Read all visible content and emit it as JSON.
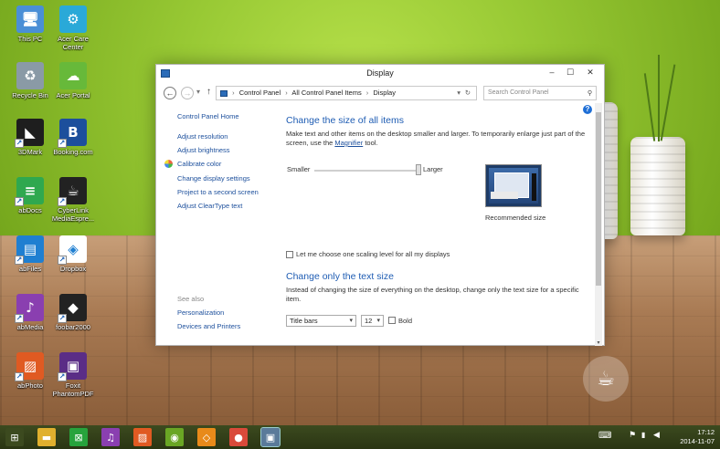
{
  "window": {
    "title": "Display",
    "controls": {
      "minimize": "–",
      "maximize": "☐",
      "close": "✕"
    }
  },
  "address": {
    "breadcrumb": [
      "Control Panel",
      "All Control Panel Items",
      "Display"
    ],
    "search_placeholder": "Search Control Panel"
  },
  "leftnav": {
    "home": "Control Panel Home",
    "items": [
      "Adjust resolution",
      "Adjust brightness",
      "Calibrate color",
      "Change display settings",
      "Project to a second screen",
      "Adjust ClearType text"
    ],
    "see_also_label": "See also",
    "see_also": [
      "Personalization",
      "Devices and Printers"
    ]
  },
  "content": {
    "heading1": "Change the size of all items",
    "para1_a": "Make text and other items on the desktop smaller and larger. To temporarily enlarge just part of the screen, use the",
    "para1_link": "Magnifier",
    "para1_b": "tool.",
    "slider_min": "Smaller",
    "slider_max": "Larger",
    "slider_level": 1.0,
    "preview_caption": "Recommended size",
    "scaling_checkbox": "Let me choose one scaling level for all my displays",
    "scaling_checked": false,
    "heading2": "Change only the text size",
    "para2": "Instead of changing the size of everything on the desktop, change only the text size for a specific item.",
    "item_select": "Title bars",
    "size_select": "12",
    "bold_label": "Bold",
    "bold_checked": false
  },
  "desktop_icons": [
    {
      "label": "This PC",
      "icon": "computer-icon",
      "color": "#4a8fd6"
    },
    {
      "label": "Acer Care Center",
      "icon": "care-center-icon",
      "color": "#2aa9d8"
    },
    {
      "label": "Recycle Bin",
      "icon": "recycle-bin-icon",
      "color": "#8a9aa6"
    },
    {
      "label": "Acer Portal",
      "icon": "cloud-icon",
      "color": "#67b93a"
    },
    {
      "label": "3DMark",
      "icon": "3dmark-icon",
      "color": "#1e1e1e"
    },
    {
      "label": "Booking.com",
      "icon": "booking-icon",
      "color": "#1c4f9c"
    },
    {
      "label": "abDocs",
      "icon": "abdocs-icon",
      "color": "#2fa84f"
    },
    {
      "label": "CyberLink MediaEspre...",
      "icon": "cyberlink-icon",
      "color": "#222222"
    },
    {
      "label": "abFiles",
      "icon": "abfiles-icon",
      "color": "#1f7fd1"
    },
    {
      "label": "Dropbox",
      "icon": "dropbox-icon",
      "color": "#ffffff"
    },
    {
      "label": "abMedia",
      "icon": "abmedia-icon",
      "color": "#8a3fb0"
    },
    {
      "label": "foobar2000",
      "icon": "foobar-icon",
      "color": "#222222"
    },
    {
      "label": "abPhoto",
      "icon": "abphoto-icon",
      "color": "#e05a22"
    },
    {
      "label": "Foxit PhantomPDF",
      "icon": "foxit-icon",
      "color": "#5a2d86"
    }
  ],
  "taskbar": {
    "apps": [
      {
        "icon": "start-icon",
        "color": "#3c4a1f"
      },
      {
        "icon": "file-explorer-icon",
        "color": "#e0b02e"
      },
      {
        "icon": "store-icon",
        "color": "#27a33c"
      },
      {
        "icon": "abmedia-taskbar-icon",
        "color": "#8a3fb0"
      },
      {
        "icon": "abphoto-taskbar-icon",
        "color": "#e05a22"
      },
      {
        "icon": "spotify-icon",
        "color": "#6aa624"
      },
      {
        "icon": "vlc-icon",
        "color": "#e88a1a"
      },
      {
        "icon": "chrome-icon",
        "color": "#d94a3a"
      },
      {
        "icon": "control-panel-taskbar-icon",
        "color": "#4a8fd6"
      }
    ],
    "time": "17:12",
    "date": "2014-11-07"
  }
}
